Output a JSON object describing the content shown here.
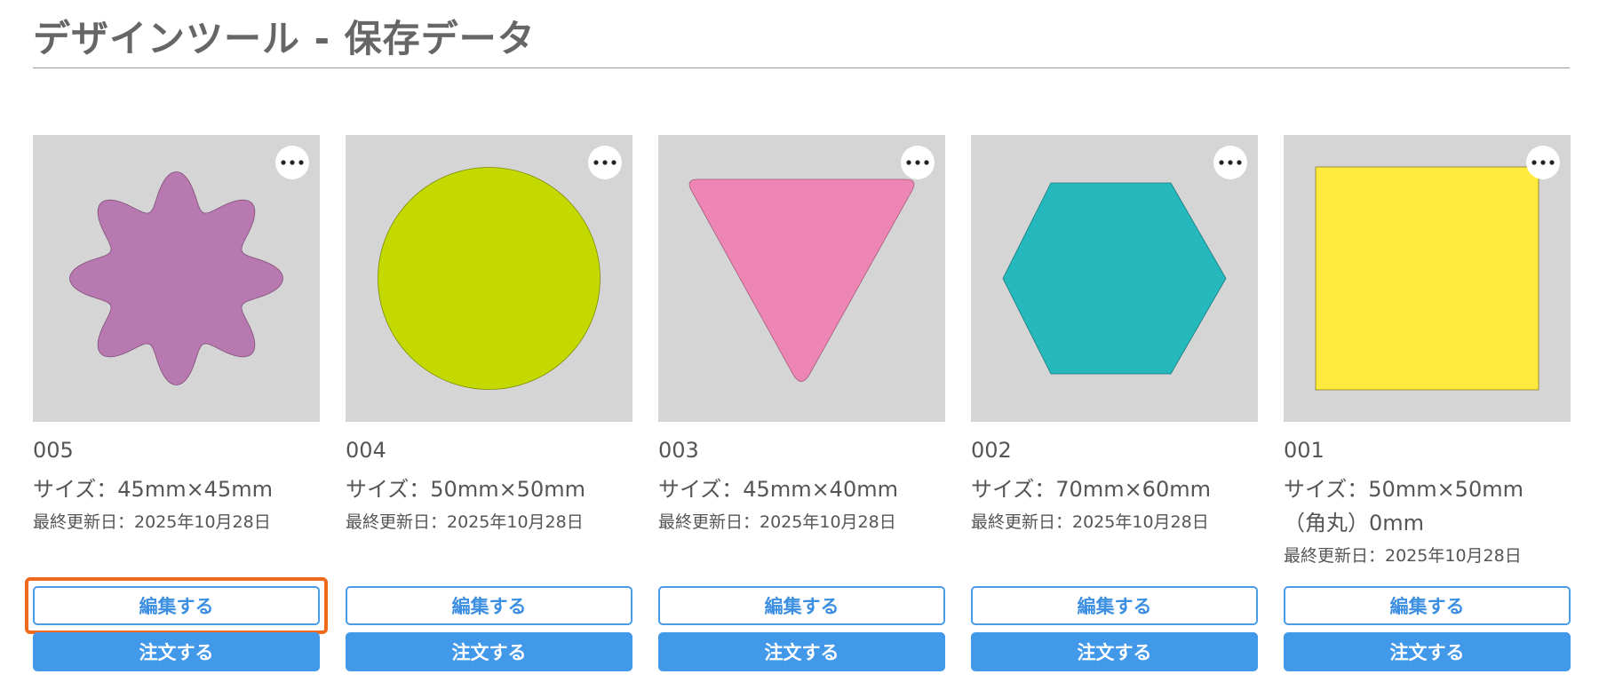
{
  "page": {
    "title": "デザインツール - 保存データ"
  },
  "colors": {
    "accent": "#4299e9",
    "highlight": "#f06a1e",
    "thumb_bg": "#d5d5d5"
  },
  "cards": [
    {
      "id": "005",
      "size": "サイズ：45mm×45mm",
      "size_extra": "",
      "updated": "最終更新日：2025年10月28日",
      "shape": "flower-shape",
      "color": "#b878b0",
      "edit_label": "編集する",
      "order_label": "注文する",
      "more_icon": "more-icon"
    },
    {
      "id": "004",
      "size": "サイズ：50mm×50mm",
      "size_extra": "",
      "updated": "最終更新日：2025年10月28日",
      "shape": "circle-shape",
      "color": "#c4d900",
      "edit_label": "編集する",
      "order_label": "注文する",
      "more_icon": "more-icon"
    },
    {
      "id": "003",
      "size": "サイズ：45mm×40mm",
      "size_extra": "",
      "updated": "最終更新日：2025年10月28日",
      "shape": "triangle-shape",
      "color": "#ed86b5",
      "edit_label": "編集する",
      "order_label": "注文する",
      "more_icon": "more-icon"
    },
    {
      "id": "002",
      "size": "サイズ：70mm×60mm",
      "size_extra": "",
      "updated": "最終更新日：2025年10月28日",
      "shape": "hexagon-shape",
      "color": "#25b8bd",
      "edit_label": "編集する",
      "order_label": "注文する",
      "more_icon": "more-icon"
    },
    {
      "id": "001",
      "size": "サイズ：50mm×50mm",
      "size_extra": "（角丸）0mm",
      "updated": "最終更新日：2025年10月28日",
      "shape": "square-shape",
      "color": "#ffea3d",
      "edit_label": "編集する",
      "order_label": "注文する",
      "more_icon": "more-icon"
    }
  ]
}
